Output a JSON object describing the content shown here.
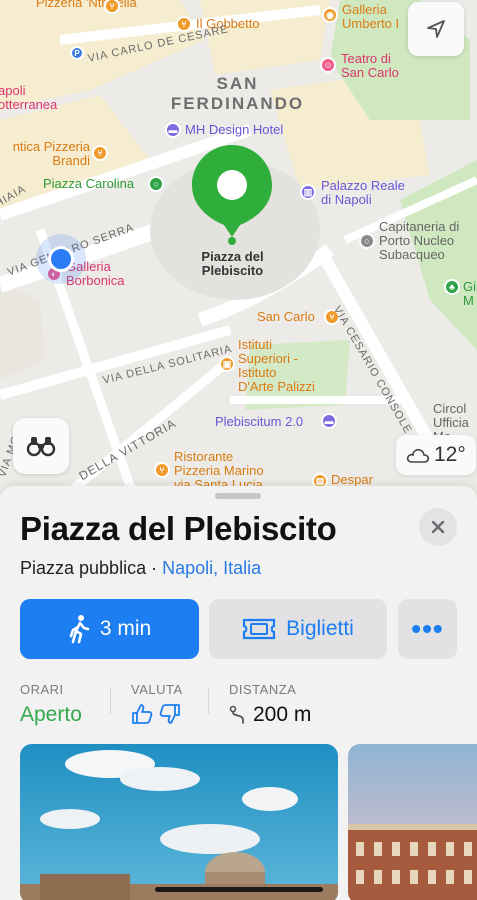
{
  "map": {
    "district": "SAN\nFERDINANDO",
    "labels": {
      "pizzeria_ntretella": "Pizzeria\n'Ntretella",
      "il_gobbetto": "Il Gobbetto",
      "galleria_umberto": "Galleria\nUmberto I",
      "teatro_san_carlo": "Teatro di\nSan Carlo",
      "napoli_sotterranea": "apoli\notterranea",
      "mh_design_hotel": "MH Design Hotel",
      "antica_pizzeria_brandi": "ntica Pizzeria\nBrandi",
      "piazza_carolina": "Piazza Carolina",
      "palazzo_reale": "Palazzo Reale\ndi Napoli",
      "capitaneria": "Capitaneria di\nPorto Nucleo\nSubacqueo",
      "galleria_borbonica": "Galleria\nBorbonica",
      "san_carlo": "San Carlo",
      "istituti_superiori": "Istituti\nSuperiori -\nIstituto\nD'Arte Palizzi",
      "plebiscitum": "Plebiscitum 2.0",
      "circolo_ufficiali": "Circol\nUfficia\nMa",
      "giardini": "Gi\nM",
      "ristorante_pizzeria_marino": "Ristorante\nPizzeria Marino\nvia Santa Lucia",
      "despar": "Despar"
    },
    "streets": {
      "via_carlo_de_cesare": "VIA CARLO DE CESARE",
      "via_gennaro_serra": "VIA GENNARO SERRA",
      "via_della_solitaria": "VIA DELLA SOLITARIA",
      "via_cesario_console": "VIA CESARIO CONSOLE",
      "della_vittoria": "DELLA VITTORIA",
      "hiaia": "HIAIA",
      "via_mon": "VIA MON"
    },
    "selected_pin_label": "Piazza del\nPlebiscito",
    "weather": {
      "temp": "12°",
      "icon": "cloud-icon"
    },
    "colors": {
      "selected_pin": "#2fae3b",
      "user_location": "#2d7cf6"
    }
  },
  "sheet": {
    "title": "Piazza del Plebiscito",
    "category": "Piazza pubblica",
    "separator": " · ",
    "location": "Napoli, Italia",
    "actions": {
      "walk": "3 min",
      "tickets": "Biglietti",
      "more": "•••"
    },
    "info": {
      "hours_label": "ORARI",
      "hours_value": "Aperto",
      "rating_label": "VALUTA",
      "distance_label": "DISTANZA",
      "distance_value": "200 m"
    },
    "colors": {
      "accent": "#1d7ef1",
      "open": "#34a94b"
    }
  }
}
